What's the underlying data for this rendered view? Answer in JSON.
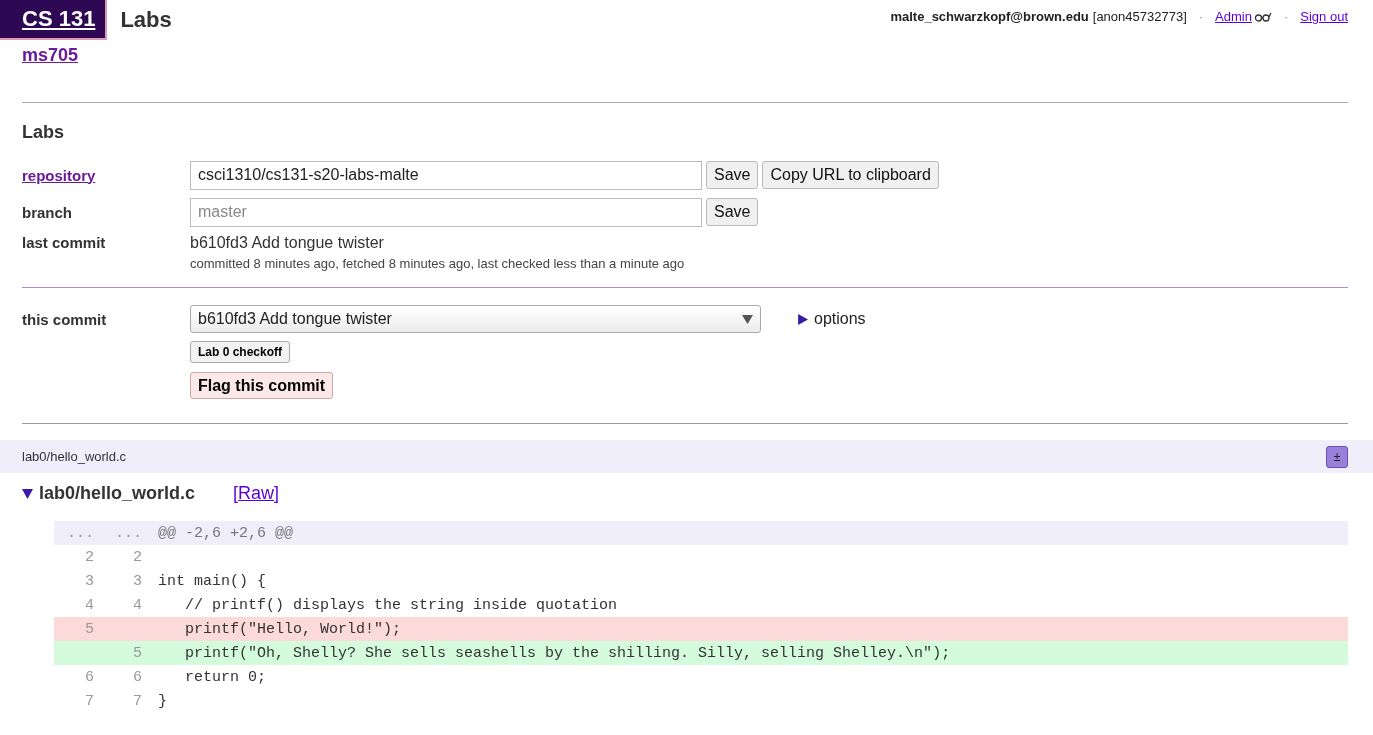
{
  "header": {
    "course": "CS 131",
    "title": "Labs",
    "user_link": "ms705",
    "email": "malte_schwarzkopf@brown.edu",
    "anon": "[anon45732773]",
    "separator_1": "·",
    "admin": "Admin",
    "separator_2": "·",
    "sign_out": "Sign out"
  },
  "section": {
    "heading": "Labs"
  },
  "repository": {
    "label": "repository",
    "value": "csci1310/cs131-s20-labs-malte",
    "save": "Save",
    "copy": "Copy URL to clipboard"
  },
  "branch": {
    "label": "branch",
    "placeholder": "master",
    "save": "Save"
  },
  "last_commit": {
    "label": "last commit",
    "title": "b610fd3 Add tongue twister",
    "details": "committed 8 minutes ago, fetched 8 minutes ago, last checked less than a minute ago"
  },
  "this_commit": {
    "label": "this commit",
    "selected_commit": "b610fd3 Add tongue twister",
    "options": {
      "label": "options",
      "expanded": false
    },
    "checkoff": "Lab 0 checkoff",
    "flag": "Flag this commit"
  },
  "file_bar": {
    "path": "lab0/hello_world.c",
    "toggle": "±"
  },
  "file": {
    "name": "lab0/hello_world.c",
    "expanded": true,
    "raw": "[Raw]",
    "lines": [
      {
        "kind": "hunk",
        "old": "...",
        "new": "...",
        "code": "@@ -2,6 +2,6 @@"
      },
      {
        "kind": "context",
        "old": "2",
        "new": "2"
      },
      {
        "kind": "context",
        "old": "3",
        "new": "3",
        "code": "int main() {"
      },
      {
        "kind": "context",
        "old": "4",
        "new": "4",
        "code": "   // printf() displays the string inside quotation"
      },
      {
        "kind": "removed",
        "old": "5",
        "code": "   printf(\"Hello, World!\");"
      },
      {
        "kind": "added",
        "new": "5",
        "code": "   printf(\"Oh, Shelly? She sells seashells by the shilling. Silly, selling Shelley.\\n\");"
      },
      {
        "kind": "context",
        "old": "6",
        "new": "6",
        "code": "   return 0;"
      },
      {
        "kind": "context",
        "old": "7",
        "new": "7",
        "code": "}"
      }
    ]
  }
}
